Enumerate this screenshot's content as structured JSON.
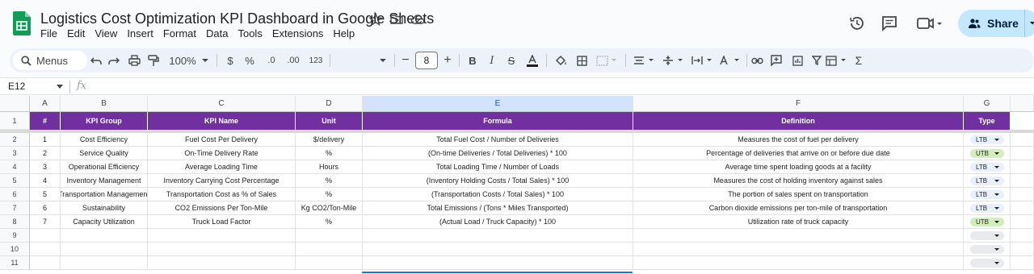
{
  "document": {
    "title": "Logistics Cost Optimization KPI Dashboard in Google Sheets"
  },
  "menu": [
    "File",
    "Edit",
    "View",
    "Insert",
    "Format",
    "Data",
    "Tools",
    "Extensions",
    "Help"
  ],
  "share": {
    "label": "Share"
  },
  "toolbar": {
    "search_label": "Menus",
    "zoom": "100%",
    "currency": "$",
    "percent": "%",
    "decrease_decimal": ".0",
    "increase_decimal": ".00",
    "number_format": "123",
    "font_size": "8"
  },
  "formula_bar": {
    "cell_ref": "E12",
    "fx": "fx"
  },
  "columns": [
    "A",
    "B",
    "C",
    "D",
    "E",
    "F",
    "G"
  ],
  "header_row": [
    "#",
    "KPI Group",
    "KPI Name",
    "Unit",
    "Formula",
    "Definition",
    "Type"
  ],
  "rows": [
    {
      "num": "1",
      "group": "Cost Efficiency",
      "name": "Fuel Cost Per Delivery",
      "unit": "$/delivery",
      "formula": "Total Fuel Cost / Number of Deliveries",
      "definition": "Measures the cost of fuel per delivery",
      "type": "LTB"
    },
    {
      "num": "2",
      "group": "Service Quality",
      "name": "On-Time Delivery Rate",
      "unit": "%",
      "formula": "(On-time Deliveries / Total Deliveries) * 100",
      "definition": "Percentage of deliveries that arrive on or before due date",
      "type": "UTB"
    },
    {
      "num": "3",
      "group": "Operational Efficiency",
      "name": "Average Loading Time",
      "unit": "Hours",
      "formula": "Total Loading Time / Number of Loads",
      "definition": "Average time spent loading goods at a facility",
      "type": "LTB"
    },
    {
      "num": "4",
      "group": "Inventory Management",
      "name": "Inventory Carrying Cost Percentage",
      "unit": "%",
      "formula": "(Inventory Holding Costs / Total Sales) * 100",
      "definition": "Measures the cost of holding inventory against sales",
      "type": "LTB"
    },
    {
      "num": "5",
      "group": "Transportation Management",
      "name": "Transportation Cost as % of Sales",
      "unit": "%",
      "formula": "(Transportation Costs / Total Sales) * 100",
      "definition": "The portion of sales spent on transportation",
      "type": "LTB"
    },
    {
      "num": "6",
      "group": "Sustainability",
      "name": "CO2 Emissions Per Ton-Mile",
      "unit": "Kg CO2/Ton-Mile",
      "formula": "Total Emissions / (Tons * Miles Transported)",
      "definition": "Carbon dioxide emissions per ton-mile of transportation",
      "type": "LTB"
    },
    {
      "num": "7",
      "group": "Capacity Utilization",
      "name": "Truck Load Factor",
      "unit": "%",
      "formula": "(Actual Load / Truck Capacity) * 100",
      "definition": "Utilization rate of truck capacity",
      "type": "UTB"
    }
  ],
  "row_numbers": [
    "1",
    "2",
    "3",
    "4",
    "5",
    "6",
    "7",
    "8",
    "9",
    "10",
    "11"
  ],
  "colors": {
    "header_bg": "#7030a0",
    "ltb_chip": "#e8f0fe",
    "utb_chip": "#d4edbc",
    "empty_chip": "#e8eaed"
  }
}
